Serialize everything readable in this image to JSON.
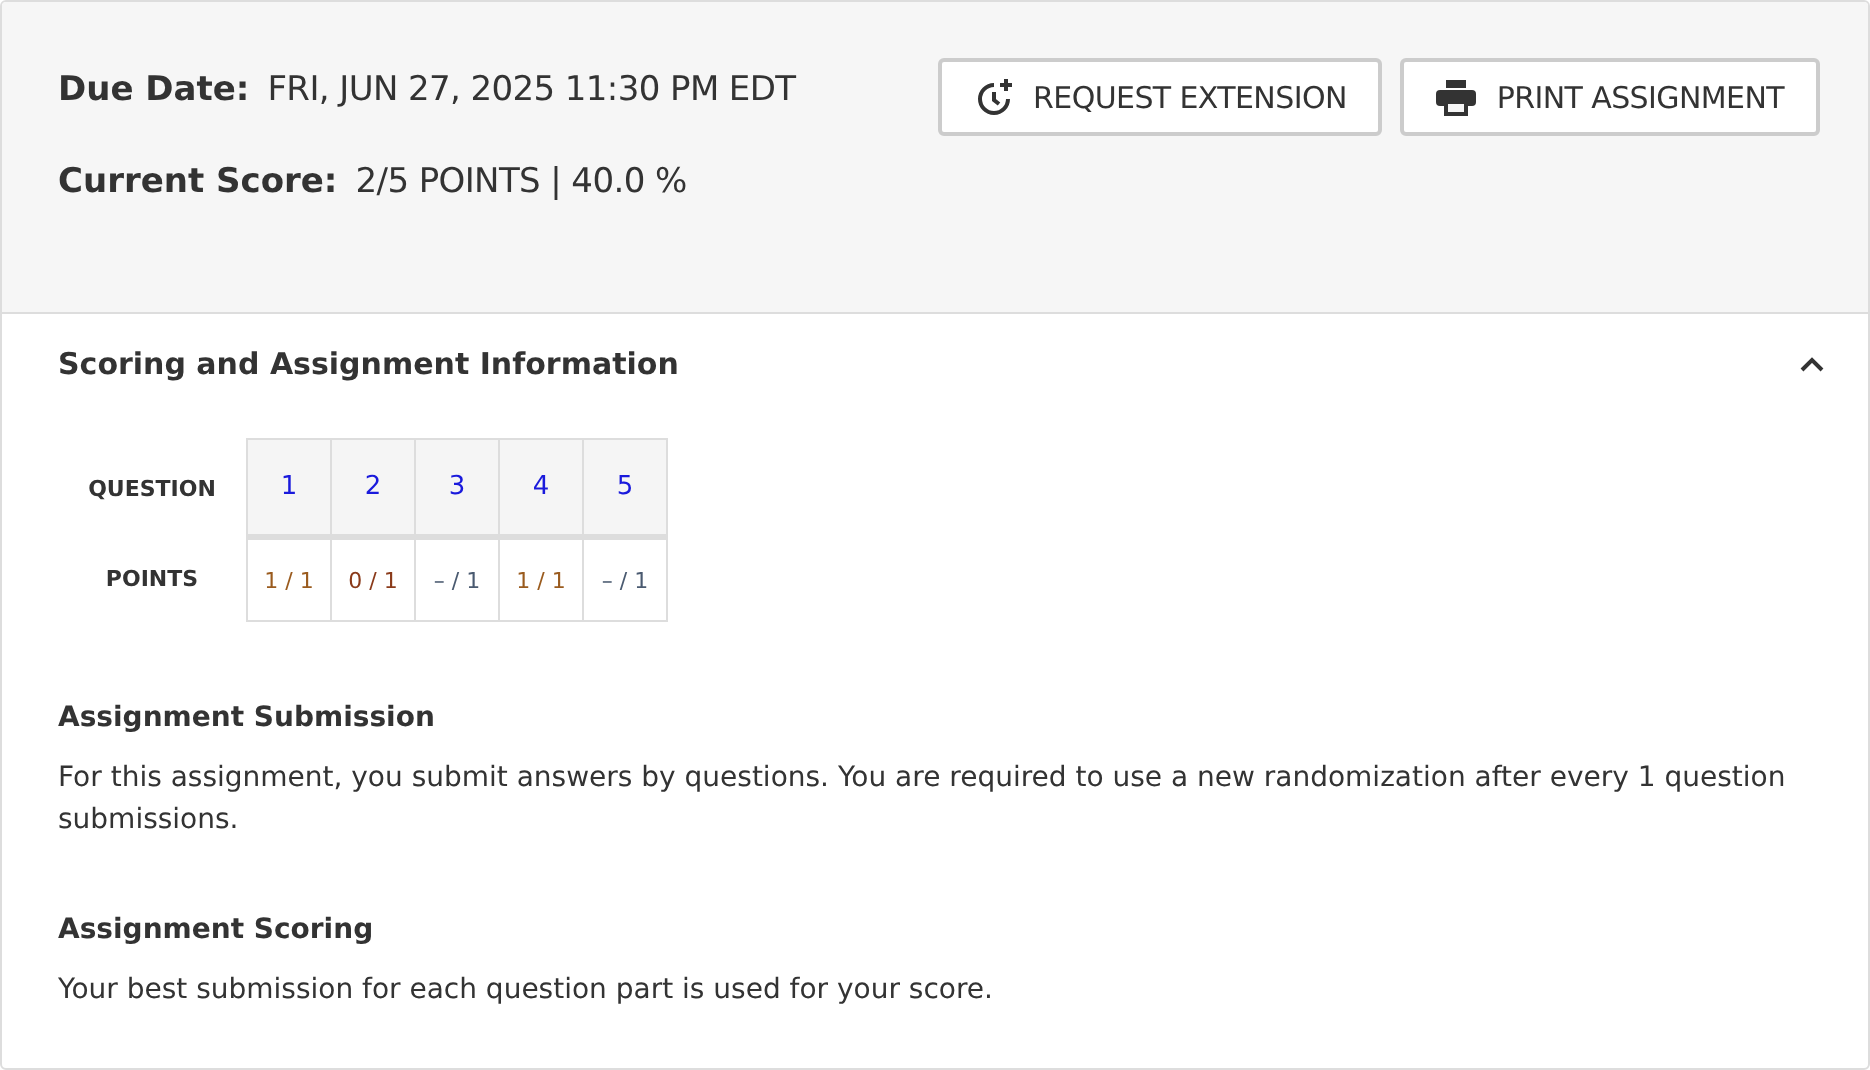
{
  "header": {
    "due_label": "Due Date:",
    "due_value": "FRI, JUN 27, 2025 11:30 PM EDT",
    "score_label": "Current Score:",
    "score_value": "2/5 POINTS | 40.0 %",
    "buttons": [
      {
        "kind": "extension",
        "label": "REQUEST EXTENSION"
      },
      {
        "kind": "print",
        "label": "PRINT ASSIGNMENT"
      }
    ]
  },
  "section": {
    "title": "Scoring and Assignment Information",
    "expanded": true,
    "table": {
      "question_label": "QUESTION",
      "points_label": "POINTS",
      "questions": [
        {
          "number": "1",
          "points": "1 / 1",
          "color": "#9a5b1e"
        },
        {
          "number": "2",
          "points": "0 / 1",
          "color": "#8a3a1a"
        },
        {
          "number": "3",
          "points": "– / 1",
          "color": "#4a5a70"
        },
        {
          "number": "4",
          "points": "1 / 1",
          "color": "#9a5b1e"
        },
        {
          "number": "5",
          "points": "– / 1",
          "color": "#4a5a70"
        }
      ]
    },
    "blocks": [
      {
        "title": "Assignment Submission",
        "text": "For this assignment, you submit answers by questions. You are required to use a new randomization after every 1 question submissions."
      },
      {
        "title": "Assignment Scoring",
        "text": "Your best submission for each question part is used for your score."
      }
    ]
  }
}
